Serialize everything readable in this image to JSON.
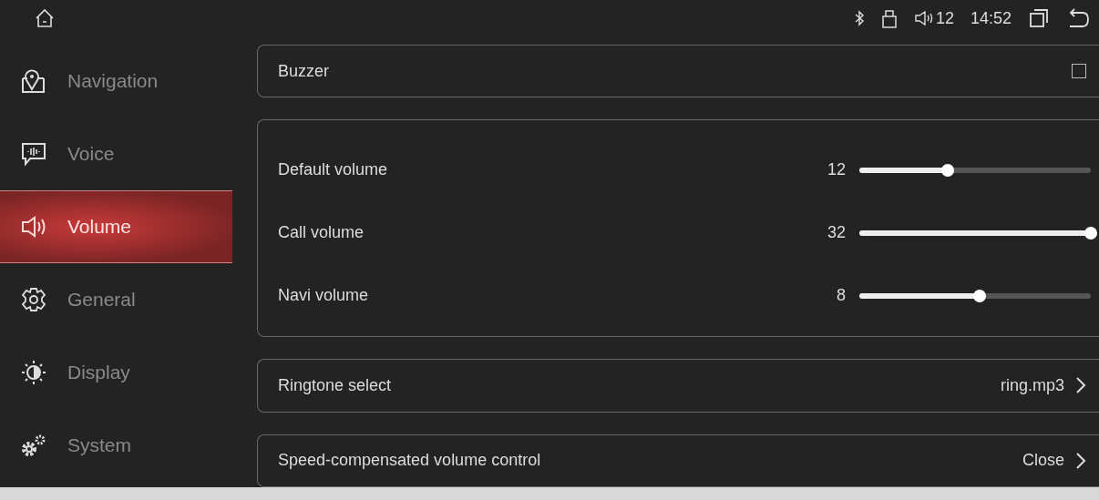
{
  "status_bar": {
    "volume": "12",
    "time": "14:52"
  },
  "sidebar": {
    "items": [
      {
        "label": "Navigation",
        "selected": false
      },
      {
        "label": "Voice",
        "selected": false
      },
      {
        "label": "Volume",
        "selected": true
      },
      {
        "label": "General",
        "selected": false
      },
      {
        "label": "Display",
        "selected": false
      },
      {
        "label": "System",
        "selected": false
      }
    ]
  },
  "settings": [
    {
      "kind": "checkbox",
      "label": "Buzzer",
      "checked": false
    },
    {
      "kind": "sliders",
      "items": [
        {
          "label": "Default volume",
          "reading": "12",
          "level": 0.38
        },
        {
          "label": "Call volume",
          "reading": "32",
          "level": 1
        },
        {
          "label": "Navi volume",
          "reading": "8",
          "level": 0.52
        }
      ]
    },
    {
      "kind": "link",
      "label": "Ringtone select",
      "value": "ring.mp3"
    },
    {
      "kind": "link",
      "label": "Speed-compensated volume control",
      "value": "Close"
    }
  ]
}
